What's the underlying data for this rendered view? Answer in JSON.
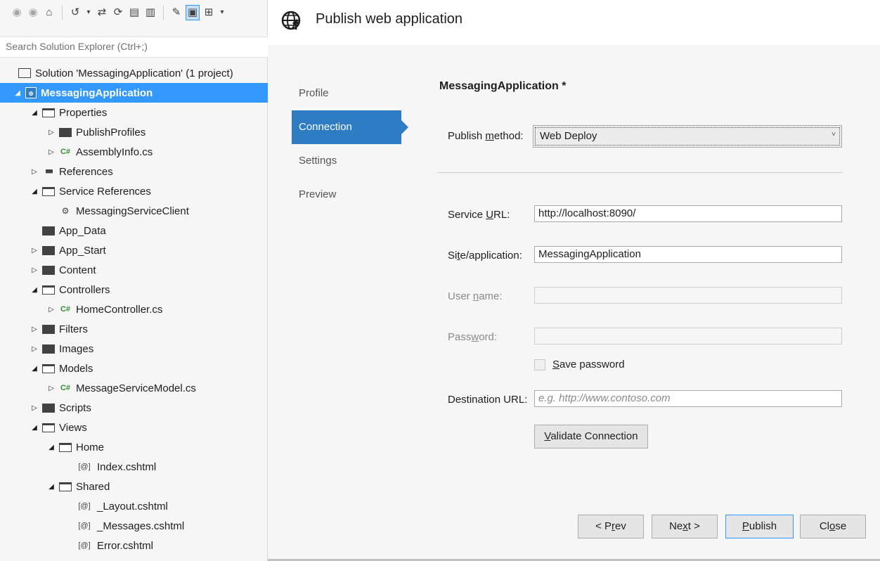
{
  "explorer": {
    "toolbar": [
      {
        "icon": "back-icon",
        "glyph": "◉"
      },
      {
        "icon": "forward-icon",
        "glyph": "◉"
      },
      {
        "icon": "home-icon",
        "glyph": "⌂"
      },
      {
        "icon": "history-icon",
        "glyph": "↺"
      },
      {
        "icon": "dropdown-icon",
        "glyph": "▾"
      },
      {
        "icon": "sync-icon",
        "glyph": "⇄"
      },
      {
        "icon": "refresh-icon",
        "glyph": "⟳"
      },
      {
        "icon": "collapse-all-icon",
        "glyph": "▤"
      },
      {
        "icon": "show-all-files-icon",
        "glyph": "▥"
      },
      {
        "icon": "properties-icon",
        "glyph": "✎"
      },
      {
        "icon": "preview-icon",
        "glyph": "▣"
      },
      {
        "icon": "class-view-icon",
        "glyph": "⊞"
      },
      {
        "icon": "dropdown-icon",
        "glyph": "▾"
      }
    ],
    "search_placeholder": "Search Solution Explorer (Ctrl+;)",
    "tree": [
      {
        "label": "Solution 'MessagingApplication' (1 project)",
        "depth": 0,
        "twist": "",
        "icon": "solution-icon"
      },
      {
        "label": "MessagingApplication",
        "depth": 0,
        "twist": "◢",
        "icon": "web-project-icon",
        "selected": true
      },
      {
        "label": "Properties",
        "depth": 1,
        "twist": "◢",
        "icon": "folder-open-icon"
      },
      {
        "label": "PublishProfiles",
        "depth": 2,
        "twist": "▷",
        "icon": "folder-icon"
      },
      {
        "label": "AssemblyInfo.cs",
        "depth": 2,
        "twist": "▷",
        "icon": "csharp-file-icon"
      },
      {
        "label": "References",
        "depth": 1,
        "twist": "▷",
        "icon": "references-icon"
      },
      {
        "label": "Service References",
        "depth": 1,
        "twist": "◢",
        "icon": "folder-open-icon"
      },
      {
        "label": "MessagingServiceClient",
        "depth": 2,
        "twist": "",
        "icon": "service-reference-icon"
      },
      {
        "label": "App_Data",
        "depth": 1,
        "twist": "",
        "icon": "folder-icon"
      },
      {
        "label": "App_Start",
        "depth": 1,
        "twist": "▷",
        "icon": "folder-icon"
      },
      {
        "label": "Content",
        "depth": 1,
        "twist": "▷",
        "icon": "folder-icon"
      },
      {
        "label": "Controllers",
        "depth": 1,
        "twist": "◢",
        "icon": "folder-open-icon"
      },
      {
        "label": "HomeController.cs",
        "depth": 2,
        "twist": "▷",
        "icon": "csharp-file-icon"
      },
      {
        "label": "Filters",
        "depth": 1,
        "twist": "▷",
        "icon": "folder-icon"
      },
      {
        "label": "Images",
        "depth": 1,
        "twist": "▷",
        "icon": "folder-icon"
      },
      {
        "label": "Models",
        "depth": 1,
        "twist": "◢",
        "icon": "folder-open-icon"
      },
      {
        "label": "MessageServiceModel.cs",
        "depth": 2,
        "twist": "▷",
        "icon": "csharp-file-icon"
      },
      {
        "label": "Scripts",
        "depth": 1,
        "twist": "▷",
        "icon": "folder-icon"
      },
      {
        "label": "Views",
        "depth": 1,
        "twist": "◢",
        "icon": "folder-open-icon"
      },
      {
        "label": "Home",
        "depth": 2,
        "twist": "◢",
        "icon": "folder-open-icon"
      },
      {
        "label": "Index.cshtml",
        "depth": 3,
        "twist": "",
        "icon": "razor-file-icon"
      },
      {
        "label": "Shared",
        "depth": 2,
        "twist": "◢",
        "icon": "folder-open-icon"
      },
      {
        "label": "_Layout.cshtml",
        "depth": 3,
        "twist": "",
        "icon": "razor-file-icon"
      },
      {
        "label": "_Messages.cshtml",
        "depth": 3,
        "twist": "",
        "icon": "razor-file-icon"
      },
      {
        "label": "Error.cshtml",
        "depth": 3,
        "twist": "",
        "icon": "razor-file-icon"
      }
    ]
  },
  "dialog": {
    "title": "Publish web application",
    "steps": [
      {
        "label": "Profile",
        "current": false
      },
      {
        "label": "Connection",
        "current": true
      },
      {
        "label": "Settings",
        "current": false
      },
      {
        "label": "Preview",
        "current": false
      }
    ],
    "profile_name": "MessagingApplication *",
    "publish_method": {
      "label": "Publish method:",
      "value": "Web Deploy"
    },
    "service_url": {
      "label": "Service URL:",
      "value": "http://localhost:8090/"
    },
    "site_application": {
      "label": "Site/application:",
      "value": "MessagingApplication"
    },
    "user_name": {
      "label": "User name:",
      "value": ""
    },
    "password": {
      "label": "Password:",
      "value": ""
    },
    "save_password": {
      "label": "Save password",
      "checked": false
    },
    "destination_url": {
      "label": "Destination URL:",
      "placeholder": "e.g. http://www.contoso.com"
    },
    "validate_button": "Validate Connection",
    "buttons": {
      "prev": "< Prev",
      "next": "Next >",
      "publish": "Publish",
      "close": "Close"
    },
    "accent_color": "#2e7cc4",
    "selection_color": "#3399ff"
  }
}
